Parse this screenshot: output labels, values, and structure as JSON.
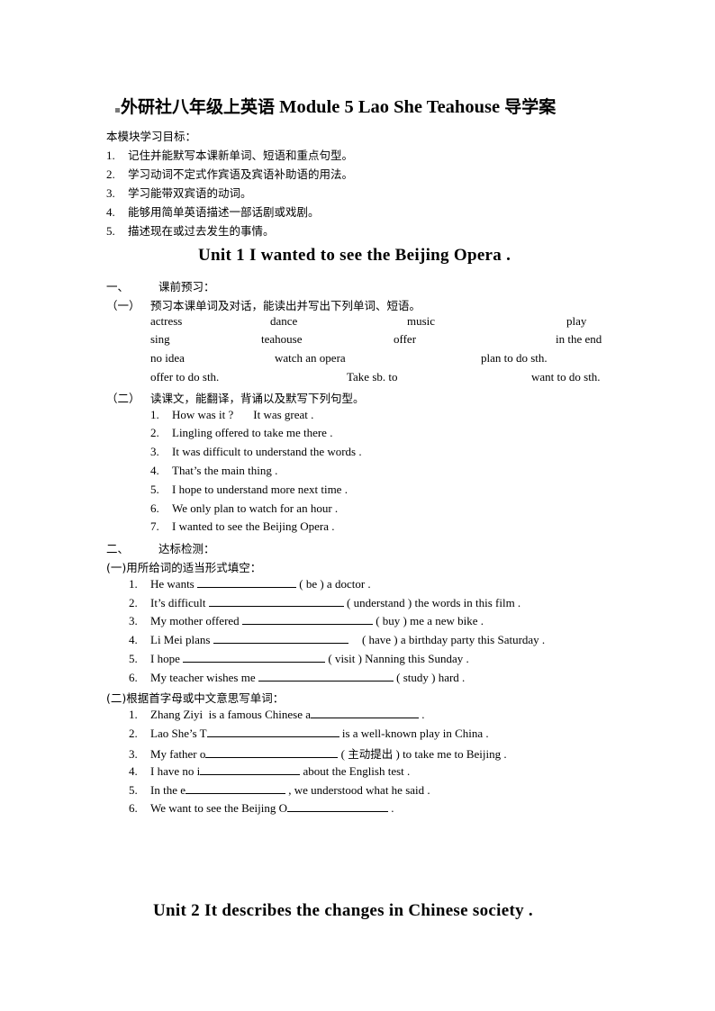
{
  "title": {
    "cn_prefix": "外研社八年级上英语",
    "en_middle": "Module 5 Lao She Teahouse",
    "cn_suffix": "导学案"
  },
  "objectives": {
    "heading": "本模块学习目标：",
    "items": [
      {
        "num": "1.",
        "text": "记住并能默写本课新单词、短语和重点句型。"
      },
      {
        "num": "2.",
        "text": "学习动词不定式作宾语及宾语补助语的用法。"
      },
      {
        "num": "3.",
        "text": "学习能带双宾语的动词。"
      },
      {
        "num": "4.",
        "text": "能够用简单英语描述一部话剧或戏剧。"
      },
      {
        "num": "5.",
        "text": "描述现在或过去发生的事情。"
      }
    ]
  },
  "unit1": {
    "title": "Unit 1 I wanted to see the Beijing Opera .",
    "section1": {
      "num": "一、",
      "label": "课前预习：",
      "sub1": {
        "num": "（一）",
        "text": "预习本课单词及对话，能读出并写出下列单词、短语。",
        "rows": [
          [
            "actress",
            "dance",
            "music",
            "play"
          ],
          [
            "sing",
            "teahouse",
            "offer",
            "in the end"
          ],
          [
            "no idea",
            "watch an opera",
            "plan to do sth."
          ],
          [
            "offer to do sth.",
            "Take sb. to",
            "want to do sth."
          ]
        ]
      },
      "sub2": {
        "num": "（二）",
        "text": "读课文，能翻译，背诵以及默写下列句型。",
        "sentences": [
          {
            "num": "1.",
            "text": "How was it ?",
            "extra": "It was great ."
          },
          {
            "num": "2.",
            "text": "Lingling offered to take me there ."
          },
          {
            "num": "3.",
            "text": "It was difficult to understand the words ."
          },
          {
            "num": "4.",
            "text": "That’s the main thing ."
          },
          {
            "num": "5.",
            "text": "I hope to understand more next time ."
          },
          {
            "num": "6.",
            "text": "We only plan to watch for an hour ."
          },
          {
            "num": "7.",
            "text": "I wanted to see the Beijing Opera ."
          }
        ]
      }
    },
    "section2": {
      "num": "二、",
      "label": "达标检测：",
      "sub1": {
        "heading": "(一)用所给词的适当形式填空：",
        "items": [
          {
            "num": "1.",
            "before": "He wants",
            "after": "( be ) a doctor ."
          },
          {
            "num": "2.",
            "before": "It’s difficult",
            "after": "( understand ) the words in this film ."
          },
          {
            "num": "3.",
            "before": "My mother offered",
            "after": "( buy ) me a new bike ."
          },
          {
            "num": "4.",
            "before": "Li Mei plans",
            "after": "( have ) a birthday party this Saturday ."
          },
          {
            "num": "5.",
            "before": "I hope",
            "after": "( visit ) Nanning this Sunday ."
          },
          {
            "num": "6.",
            "before": "My teacher wishes me",
            "after": "( study ) hard ."
          }
        ]
      },
      "sub2": {
        "heading": "(二)根据首字母或中文意思写单词：",
        "items": [
          {
            "num": "1.",
            "before": "Zhang Ziyi  is a famous Chinese a",
            "after": "."
          },
          {
            "num": "2.",
            "before": "Lao She’s T",
            "after": "is a well-known play in China ."
          },
          {
            "num": "3.",
            "before": "My father o",
            "hint_open": "(",
            "hint": "主动提出",
            "after": ") to take me to Beijing ."
          },
          {
            "num": "4.",
            "before": "I have no i",
            "after": "about the English test ."
          },
          {
            "num": "5.",
            "before": "In the e",
            "after": ", we understood what he said ."
          },
          {
            "num": "6.",
            "before": "We want to see the Beijing O",
            "after": "."
          }
        ]
      }
    }
  },
  "unit2": {
    "title": "Unit 2 It describes the changes in Chinese society ."
  }
}
